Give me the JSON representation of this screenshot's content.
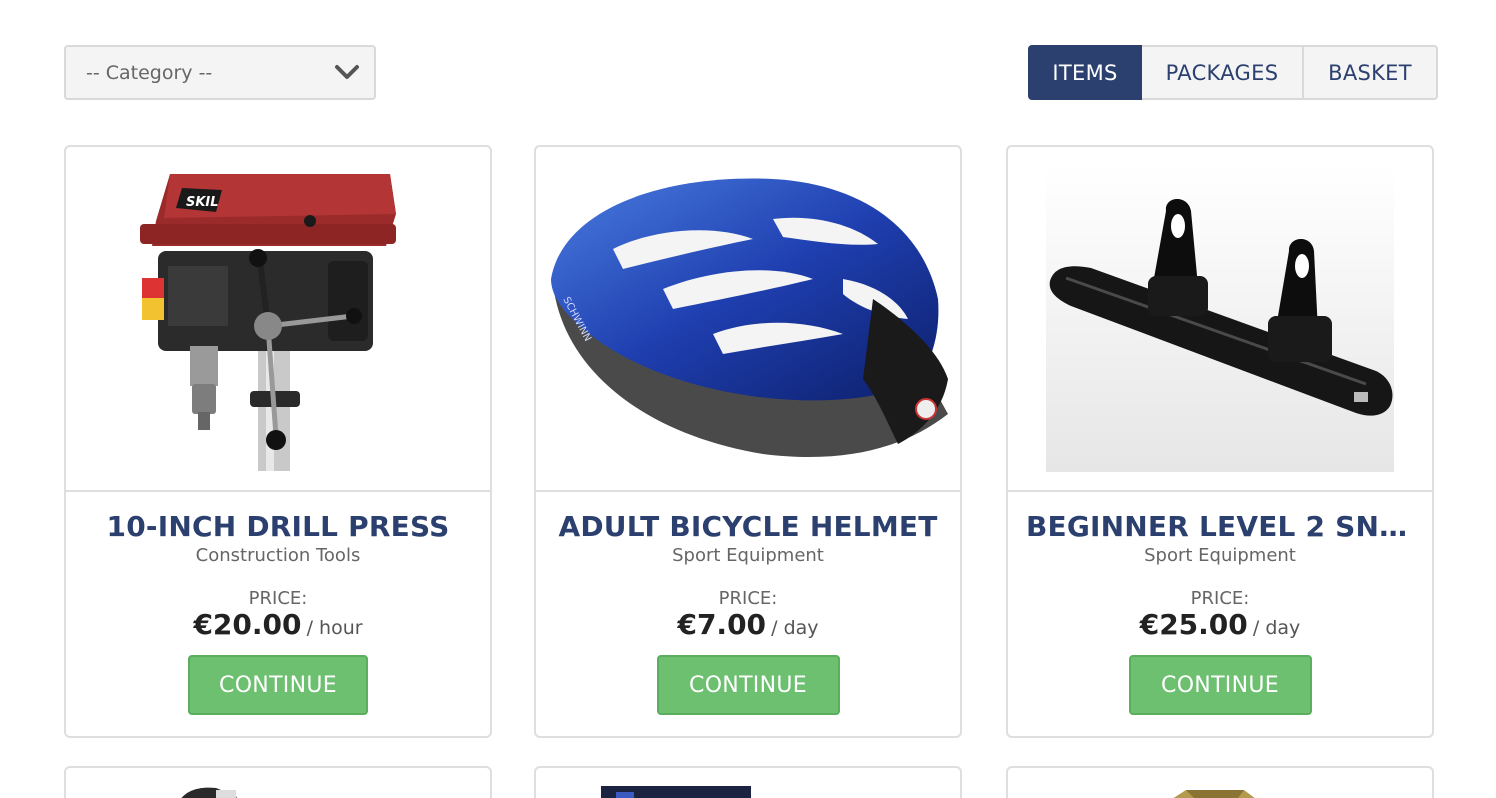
{
  "filter": {
    "category_placeholder": "-- Category --"
  },
  "tabs": [
    {
      "label": "ITEMS",
      "active": true
    },
    {
      "label": "PACKAGES",
      "active": false
    },
    {
      "label": "BASKET",
      "active": false
    }
  ],
  "products": [
    {
      "title": "10-INCH DRILL PRESS",
      "category": "Construction Tools",
      "price_label": "PRICE:",
      "price": "€20.00",
      "unit": "/ hour",
      "button": "CONTINUE",
      "image": "drill-press-image",
      "brand": "SKIL"
    },
    {
      "title": "ADULT BICYCLE HELMET",
      "category": "Sport Equipment",
      "price_label": "PRICE:",
      "price": "€7.00",
      "unit": "/ day",
      "button": "CONTINUE",
      "image": "bicycle-helmet-image",
      "brand": "SCHWINN"
    },
    {
      "title": "BEGINNER LEVEL 2 SNO...",
      "category": "Sport Equipment",
      "price_label": "PRICE:",
      "price": "€25.00",
      "unit": "/ day",
      "button": "CONTINUE",
      "image": "snowboard-image"
    }
  ],
  "colors": {
    "accent": "#2c4070",
    "continue_button": "#6cc070",
    "border": "#dedede"
  }
}
